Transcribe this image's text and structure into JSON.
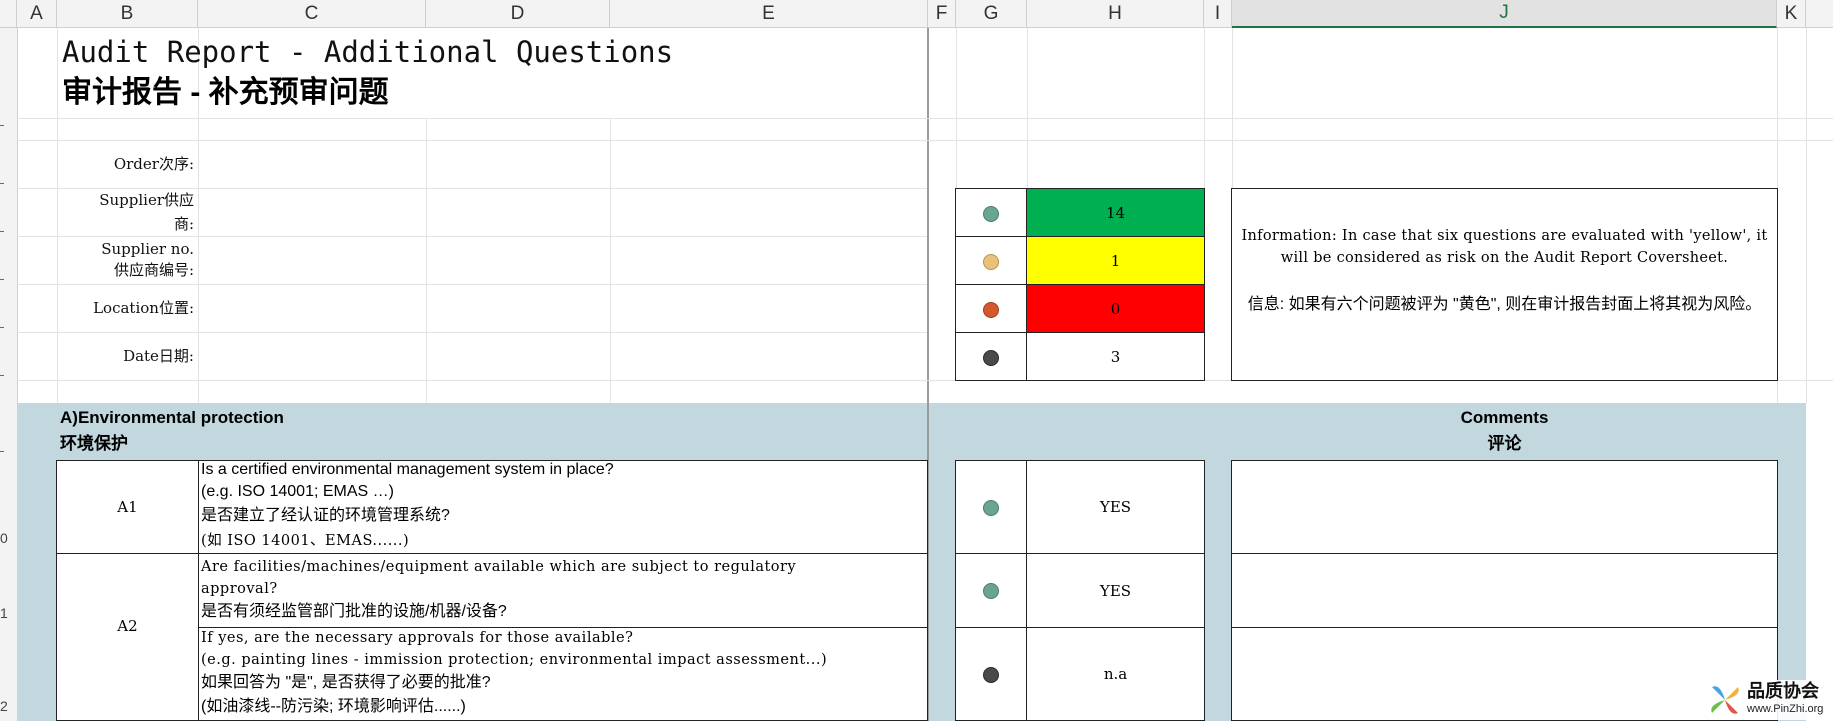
{
  "columns": [
    {
      "id": "A"
    },
    {
      "id": "B"
    },
    {
      "id": "C"
    },
    {
      "id": "D"
    },
    {
      "id": "E"
    },
    {
      "id": "F"
    },
    {
      "id": "G"
    },
    {
      "id": "H"
    },
    {
      "id": "I"
    },
    {
      "id": "J"
    },
    {
      "id": "K"
    }
  ],
  "row_numbers": [
    "0",
    "1",
    "2"
  ],
  "title": {
    "en": "Audit Report - Additional Questions",
    "cn": "审计报告 - 补充预审问题"
  },
  "fields": {
    "order": "Order次序:",
    "supplier_1": "Supplier供应",
    "supplier_2": "商:",
    "supplier_no_1": "Supplier no.",
    "supplier_no_2": "供应商编号:",
    "location": "Location位置:",
    "date": "Date日期:"
  },
  "summary": {
    "green_count": "14",
    "yellow_count": "1",
    "red_count": "0",
    "na_count": "3",
    "colors": {
      "green": "#00b050",
      "yellow": "#ffff00",
      "red": "#ff0000",
      "dot_green": "#6aa58f",
      "dot_yellow": "#e8c27a",
      "dot_red": "#d4572e",
      "dot_gray": "#4a4a4a"
    },
    "info_en": "Information: In case that six questions are evaluated with 'yellow', it will be considered as risk on the Audit Report Coversheet.",
    "info_cn": "信息: 如果有六个问题被评为 \"黄色\", 则在审计报告封面上将其视为风险。"
  },
  "section": {
    "title_en": "A)Environmental protection",
    "title_cn": "环境保护",
    "comments_en": "Comments",
    "comments_cn": "评论",
    "band_color": "#c2d7de"
  },
  "questions": [
    {
      "id": "A1",
      "lines": [
        "Is a certified environmental management system in place?",
        "(e.g. ISO 14001; EMAS …)",
        "是否建立了经认证的环境管理系统?",
        "(如 ISO 14001、EMAS......)"
      ],
      "answer": "YES"
    },
    {
      "id": "A2",
      "lines": [
        "Are facilities/machines/equipment available which are subject to regulatory",
        "approval?",
        "是否有须经监管部门批准的设施/机器/设备?"
      ],
      "answer": "YES"
    },
    {
      "id": "",
      "lines": [
        "If yes, are the necessary approvals for those available?",
        "(e.g. painting lines - immission protection; environmental impact assessment...)",
        "如果回答为 \"是\", 是否获得了必要的批准?",
        "(如油漆线--防污染; 环境影响评估......)"
      ],
      "answer": "n.a"
    }
  ],
  "watermark": {
    "name": "品质协会",
    "url": "www.PinZhi.org"
  }
}
